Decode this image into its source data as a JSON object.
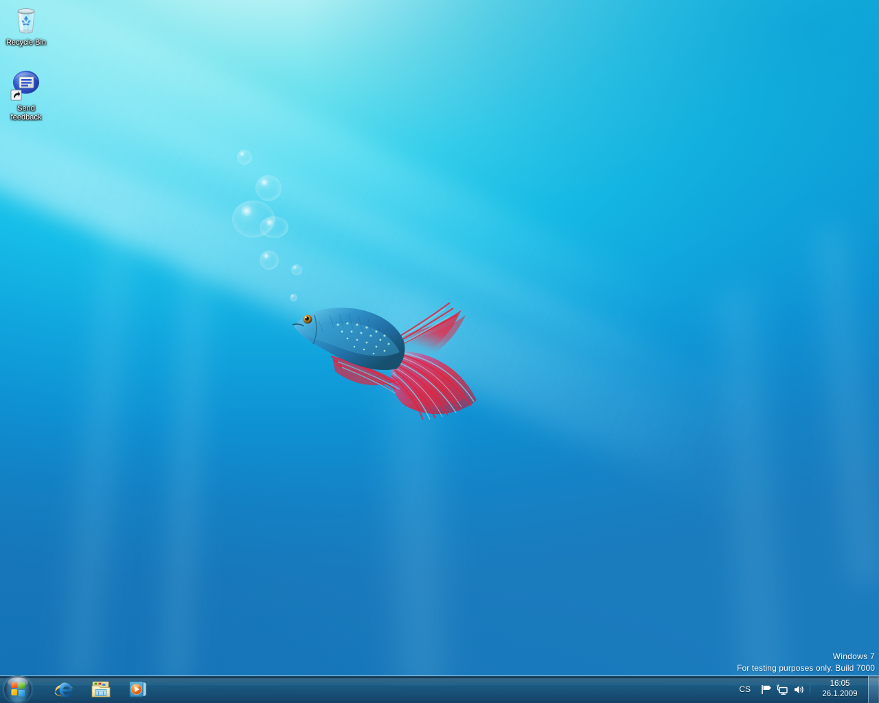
{
  "os": {
    "watermark_line1": "Windows  7",
    "watermark_line2": "For testing purposes only. Build 7000"
  },
  "wallpaper": {
    "name": "betta-fish-underwater",
    "top_color": "#d9f7f8",
    "mid_color": "#1fc3e8",
    "bottom_color": "#1a7bbd"
  },
  "desktop": {
    "icons": [
      {
        "name": "recycle-bin",
        "label": "Recycle Bin",
        "icon": "recycle-bin-icon"
      },
      {
        "name": "send-feedback",
        "label": "Send\nfeedback",
        "icon": "send-feedback-icon"
      }
    ]
  },
  "taskbar": {
    "start_button": {
      "name": "start-orb",
      "tooltip": "Start"
    },
    "pinned": [
      {
        "name": "internet-explorer",
        "label": "Internet Explorer",
        "icon": "internet-explorer-icon"
      },
      {
        "name": "windows-explorer",
        "label": "Windows Explorer",
        "icon": "folder-icon"
      },
      {
        "name": "windows-media-player",
        "label": "Windows Media Player",
        "icon": "media-player-icon"
      }
    ],
    "tray": {
      "language": "CS",
      "icons": [
        {
          "name": "action-center",
          "label": "Action Center",
          "icon": "flag-icon"
        },
        {
          "name": "network",
          "label": "Network",
          "icon": "network-icon"
        },
        {
          "name": "volume",
          "label": "Volume",
          "icon": "speaker-icon"
        }
      ],
      "clock": {
        "time": "16:05",
        "date": "26.1.2009"
      },
      "show_desktop": {
        "name": "show-desktop",
        "label": "Show desktop"
      }
    }
  }
}
